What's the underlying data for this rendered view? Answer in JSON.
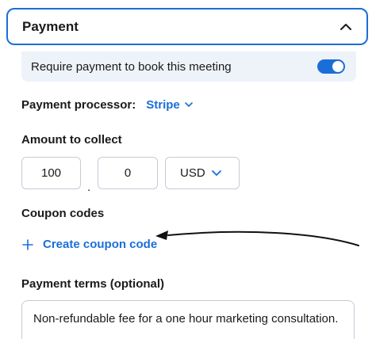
{
  "section": {
    "title": "Payment"
  },
  "require_payment": {
    "label": "Require payment to book this meeting",
    "enabled": true
  },
  "processor": {
    "label": "Payment processor:",
    "value": "Stripe"
  },
  "amount": {
    "label": "Amount to collect",
    "major": "100",
    "separator": ".",
    "minor": "0",
    "currency": "USD"
  },
  "coupons": {
    "label": "Coupon codes",
    "create_label": "Create coupon code"
  },
  "terms": {
    "label": "Payment terms (optional)",
    "value": "Non-refundable fee for a one hour marketing consultation."
  },
  "colors": {
    "accent": "#1a6ed8",
    "highlight_bg": "#eef3fa",
    "border": "#c4ccd6"
  }
}
